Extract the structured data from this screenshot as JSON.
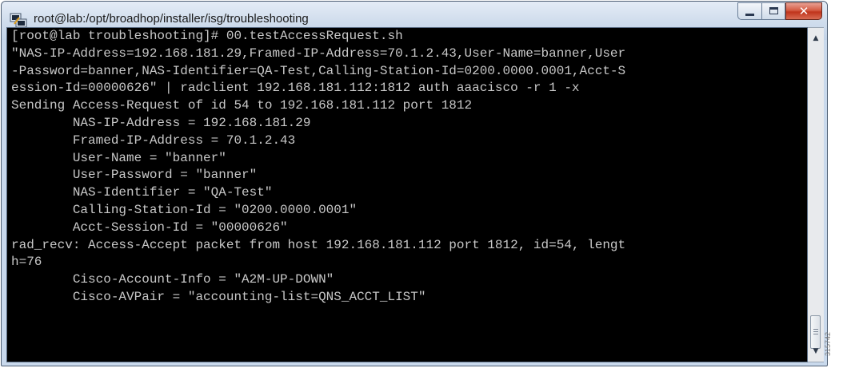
{
  "window": {
    "title": "root@lab:/opt/broadhop/installer/isg/troubleshooting",
    "icon": "putty-icon",
    "buttons": {
      "minimize": "minimize",
      "maximize": "maximize",
      "close": "close"
    }
  },
  "terminal": {
    "lines": [
      "[root@lab troubleshooting]# 00.testAccessRequest.sh",
      "\"NAS-IP-Address=192.168.181.29,Framed-IP-Address=70.1.2.43,User-Name=banner,User",
      "-Password=banner,NAS-Identifier=QA-Test,Calling-Station-Id=0200.0000.0001,Acct-S",
      "ession-Id=00000626\" | radclient 192.168.181.112:1812 auth aaacisco -r 1 -x",
      "Sending Access-Request of id 54 to 192.168.181.112 port 1812",
      "        NAS-IP-Address = 192.168.181.29",
      "        Framed-IP-Address = 70.1.2.43",
      "        User-Name = \"banner\"",
      "        User-Password = \"banner\"",
      "        NAS-Identifier = \"QA-Test\"",
      "        Calling-Station-Id = \"0200.0000.0001\"",
      "        Acct-Session-Id = \"00000626\"",
      "rad_recv: Access-Accept packet from host 192.168.181.112 port 1812, id=54, lengt",
      "h=76",
      "        Cisco-Account-Info = \"A2M-UP-DOWN\"",
      "        Cisco-AVPair = \"accounting-list=QNS_ACCT_LIST\""
    ]
  },
  "figure_id": "315742"
}
